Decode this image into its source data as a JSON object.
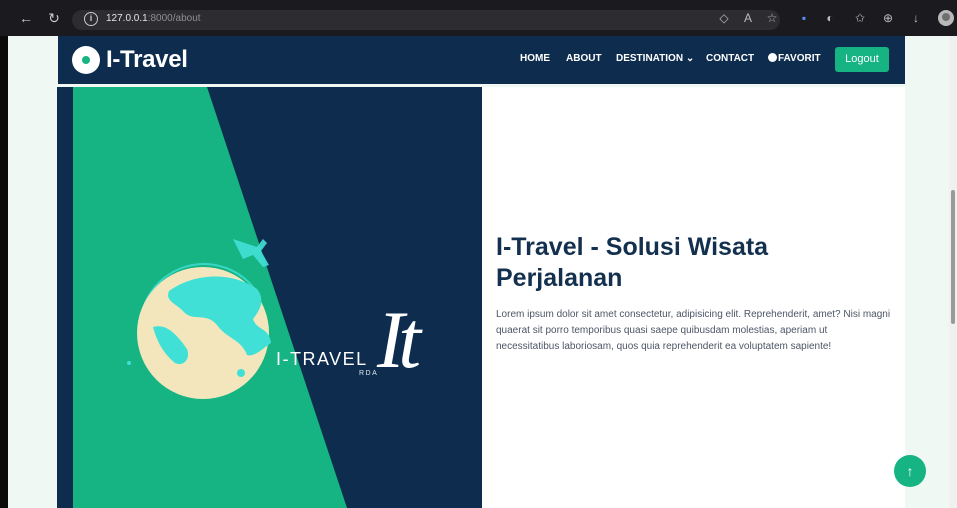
{
  "browser": {
    "back_icon": "arrow-left-icon",
    "reload_icon": "reload-icon",
    "url_host": "127.0.0.1",
    "url_rest": ":8000/about",
    "toolbar_icons": [
      "tag-icon",
      "read-aloud-icon",
      "tracking-icon",
      "extension-icon",
      "copilot-icon",
      "favorites-icon",
      "collections-icon",
      "download-icon"
    ]
  },
  "navbar": {
    "brand": "I-Travel",
    "items": {
      "home": "HOME",
      "about": "ABOUT",
      "destination": "DESTINATION",
      "contact": "CONTACT",
      "favorit": "FAVORIT"
    },
    "logout": "Logout"
  },
  "about_image": {
    "brand_text": "I-TRAVEL",
    "brand_sub": "RDA",
    "monogram": "It"
  },
  "about": {
    "title": "I-Travel - Solusi Wisata Perjalanan",
    "paragraph": "Lorem ipsum dolor sit amet consectetur, adipisicing elit. Reprehenderit, amet? Nisi magni quaerat sit porro temporibus quasi saepe quibusdam molestias, aperiam ut necessitatibus laboriosam, quos quia reprehenderit ea voluptatem sapiente!"
  },
  "back_to_top": "↑",
  "colors": {
    "navy": "#0e2d4e",
    "accent": "#16b383",
    "globe_sea": "#41e0d6",
    "globe_land": "#f3e6bd",
    "page_bg": "#f0f8f3"
  }
}
